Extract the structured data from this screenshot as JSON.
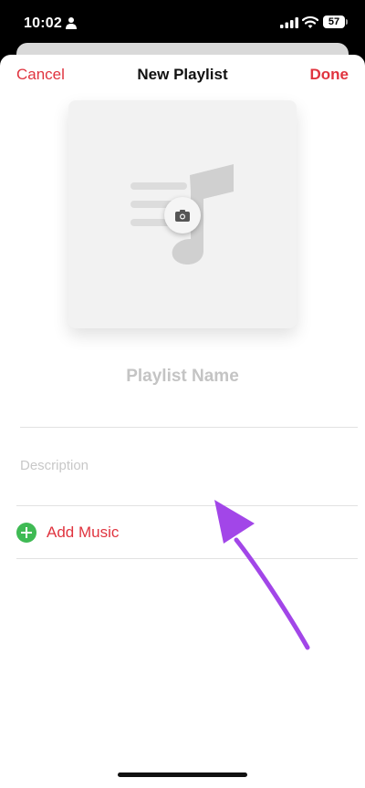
{
  "status_bar": {
    "time": "10:02",
    "battery": "57",
    "icons": [
      "person-icon",
      "signal-icon",
      "wifi-icon",
      "battery-icon"
    ]
  },
  "nav": {
    "cancel": "Cancel",
    "title": "New Playlist",
    "done": "Done"
  },
  "artwork": {
    "icon": "music-note-icon",
    "camera_icon": "camera-icon"
  },
  "fields": {
    "playlist_name_placeholder": "Playlist Name",
    "description_placeholder": "Description"
  },
  "add_music": {
    "label": "Add Music",
    "icon": "plus-circle-icon"
  },
  "colors": {
    "accent": "#e0343f",
    "add_green": "#3fba54",
    "annotation": "#a246e8"
  }
}
